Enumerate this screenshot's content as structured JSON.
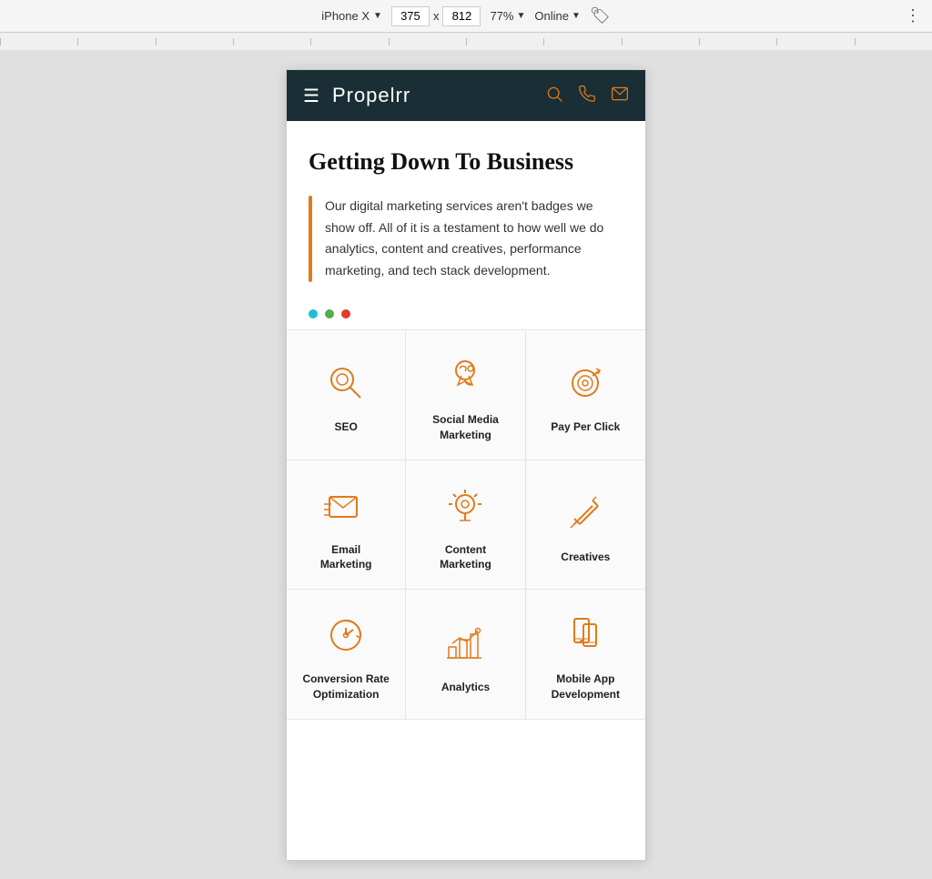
{
  "browserBar": {
    "device": "iPhone X",
    "width": "375",
    "height": "812",
    "zoom": "77%",
    "connection": "Online",
    "chevron": "▼",
    "xLabel": "x",
    "moreIcon": "⋮"
  },
  "navbar": {
    "brand": "Propelrr",
    "hamburgerLabel": "menu",
    "searchLabel": "search",
    "phoneLabel": "phone",
    "mailLabel": "mail"
  },
  "hero": {
    "title": "Getting Down To Business",
    "bodyText": "Our digital marketing services aren't badges we show off. All of it is a testament to how well we do analytics, content and creatives, performance marketing, and tech stack development."
  },
  "dots": [
    {
      "color": "#1bbfd4"
    },
    {
      "color": "#4caf50"
    },
    {
      "color": "#e03c2d"
    }
  ],
  "services": [
    {
      "id": "seo",
      "label": "SEO",
      "icon": "search"
    },
    {
      "id": "social-media",
      "label": "Social Media Marketing",
      "icon": "social"
    },
    {
      "id": "pay-per-click",
      "label": "Pay Per Click",
      "icon": "target"
    },
    {
      "id": "email-marketing",
      "label": "Email Marketing",
      "icon": "email"
    },
    {
      "id": "content-marketing",
      "label": "Content Marketing",
      "icon": "bulb"
    },
    {
      "id": "creatives",
      "label": "Creatives",
      "icon": "creative"
    },
    {
      "id": "conversion-rate",
      "label": "Conversion Rate Optimization",
      "icon": "gear"
    },
    {
      "id": "analytics",
      "label": "Analytics",
      "icon": "chart"
    },
    {
      "id": "mobile-app",
      "label": "Mobile App Development",
      "icon": "mobile"
    }
  ]
}
